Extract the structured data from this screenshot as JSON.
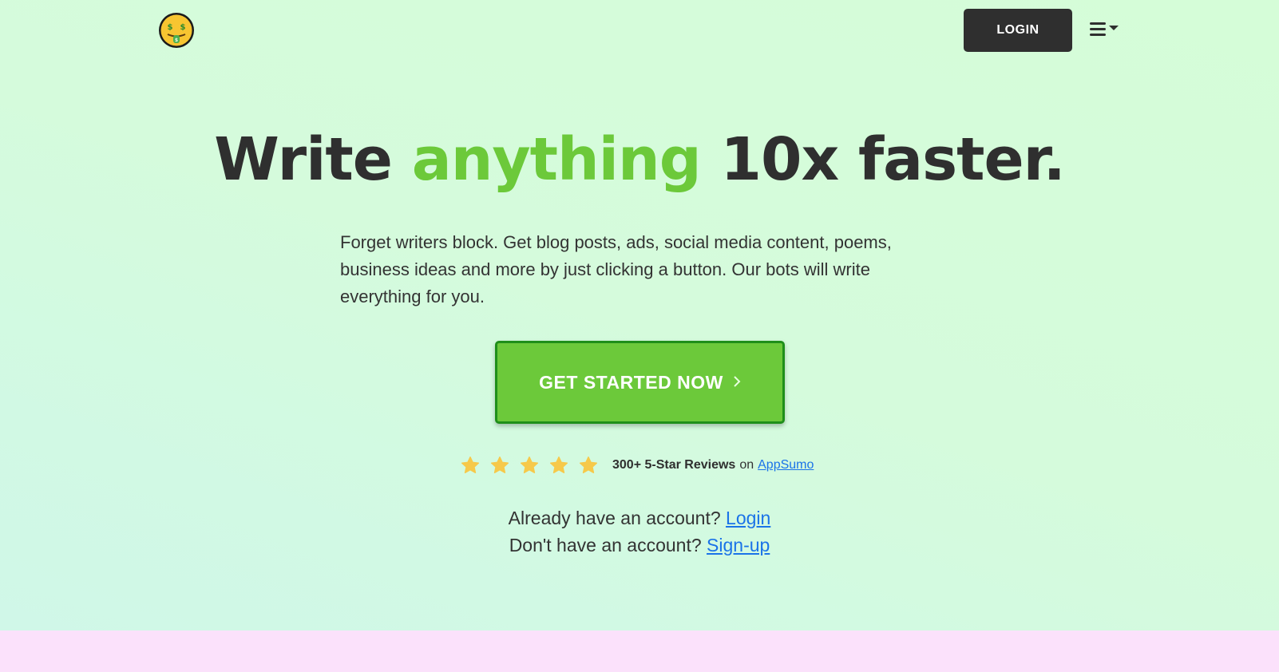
{
  "header": {
    "logo_icon": "money-mouth-face-icon",
    "login_label": "LOGIN",
    "menu_icon": "hamburger-menu-icon"
  },
  "hero": {
    "headline_before": "Write",
    "headline_accent": "anything",
    "headline_after": "10x faster.",
    "subtitle": "Forget writers block. Get blog posts, ads, social media content, poems, business ideas and more by just clicking a button. Our bots will write everything for you.",
    "cta_label": "GET STARTED NOW",
    "cta_icon": "chevron-right-icon"
  },
  "reviews": {
    "rating": 5,
    "max_rating": 5,
    "count_label": "300+ 5-Star Reviews",
    "on": "on",
    "source_link": "AppSumo"
  },
  "account": {
    "have_account": "Already have an account?",
    "login_link": "Login",
    "no_account": "Don't have an account?",
    "signup_link": "Sign-up"
  },
  "colors": {
    "accent": "#6cc93a",
    "dark": "#2f2f2f",
    "link": "#1a73e8",
    "star": "#f6c94a"
  }
}
